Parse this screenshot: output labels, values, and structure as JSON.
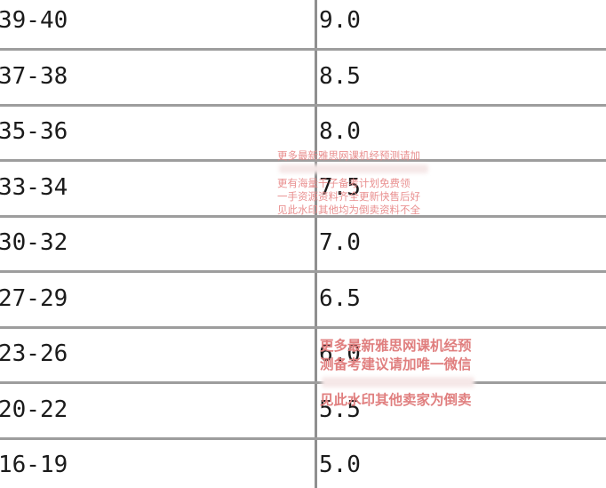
{
  "table": {
    "rows": [
      {
        "score": "39-40",
        "band": "9.0"
      },
      {
        "score": "37-38",
        "band": "8.5"
      },
      {
        "score": "35-36",
        "band": "8.0"
      },
      {
        "score": "33-34",
        "band": "7.5"
      },
      {
        "score": "30-32",
        "band": "7.0"
      },
      {
        "score": "27-29",
        "band": "6.5"
      },
      {
        "score": "23-26",
        "band": "6.0"
      },
      {
        "score": "20-22",
        "band": "5.5"
      },
      {
        "score": "16-19",
        "band": "5.0"
      }
    ]
  },
  "watermark_small": {
    "line1": "更多最新雅思网课机经预测请加",
    "line2": "更有海量千子备考计划免费领",
    "line3": "一手资源资料齐全更新快售后好",
    "line4": "见此水印其他均为倒卖资料不全"
  },
  "watermark_large": {
    "line1": "更多最新雅思网课机经预",
    "line2": "测备考建议请加唯一微信",
    "line3": "见此水印其他卖家为倒卖"
  },
  "colors": {
    "grid": "#9d9d9d",
    "text": "#1b1b1b",
    "watermark": "#e88a8a"
  }
}
